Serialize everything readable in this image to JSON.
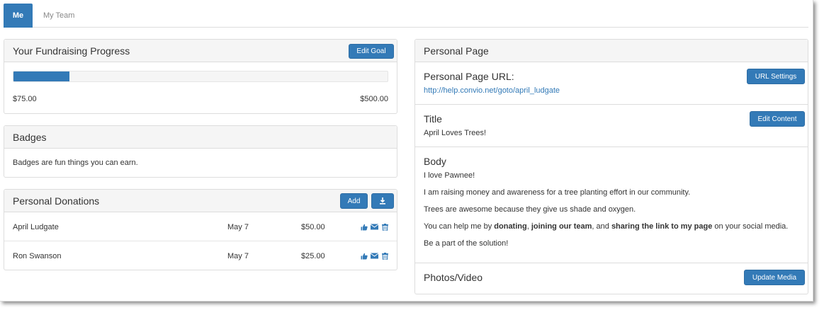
{
  "tabs": [
    {
      "label": "Me",
      "active": true
    },
    {
      "label": "My Team",
      "active": false
    }
  ],
  "fundraising": {
    "title": "Your Fundraising Progress",
    "edit_goal_label": "Edit Goal",
    "raised": "$75.00",
    "goal": "$500.00",
    "progress_fraction": 0.15
  },
  "badges": {
    "title": "Badges",
    "text": "Badges are fun things you can earn."
  },
  "donations": {
    "title": "Personal Donations",
    "add_label": "Add",
    "download_icon": "download-icon",
    "rows": [
      {
        "name": "April Ludgate",
        "date": "May 7",
        "amount": "$50.00"
      },
      {
        "name": "Ron Swanson",
        "date": "May 7",
        "amount": "$25.00"
      }
    ],
    "row_icons": [
      "thumbs-up-icon",
      "envelope-icon",
      "trash-icon"
    ]
  },
  "personal_page": {
    "title": "Personal Page",
    "url_section": {
      "label": "Personal Page URL:",
      "button": "URL Settings",
      "url": "http://help.convio.net/goto/april_ludgate"
    },
    "title_section": {
      "label": "Title",
      "button": "Edit Content",
      "value": "April Loves Trees!"
    },
    "body_section": {
      "label": "Body",
      "lines": [
        "I love Pawnee!",
        "I am raising money and awareness for a tree planting effort in our community.",
        "Trees are awesome because they give us shade and oxygen.",
        "Be a part of the solution!"
      ],
      "help_line": {
        "prefix": "You can help me by ",
        "bold1": "donating",
        "sep1": ", ",
        "bold2": "joining our team",
        "sep2": ", and ",
        "bold3": "sharing the link to my page",
        "suffix": " on your social media."
      }
    },
    "media_section": {
      "label": "Photos/Video",
      "button": "Update Media"
    }
  },
  "colors": {
    "primary": "#337ab7",
    "panel_heading_bg": "#f5f5f5",
    "border": "#dddddd"
  }
}
